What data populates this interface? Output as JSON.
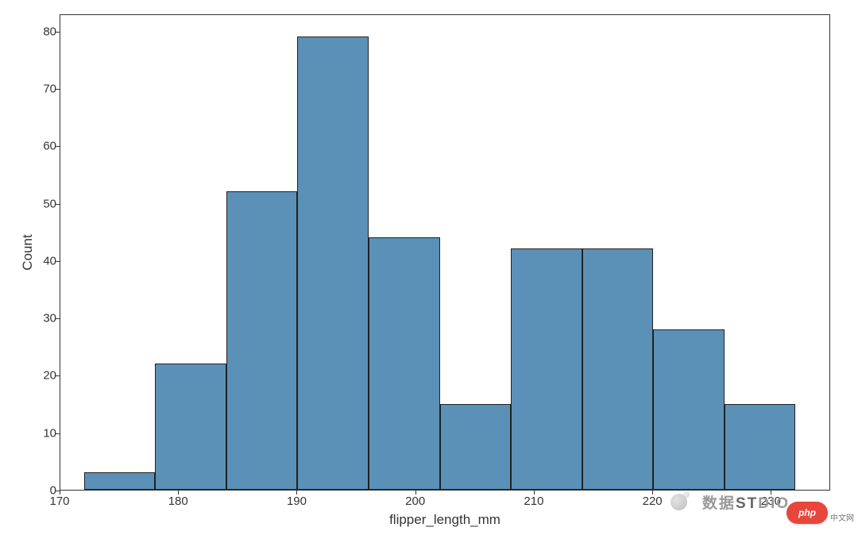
{
  "chart_data": {
    "type": "bar",
    "title": "",
    "xlabel": "flipper_length_mm",
    "ylabel": "Count",
    "xlim": [
      170,
      235
    ],
    "ylim": [
      0,
      83
    ],
    "x_ticks": [
      170,
      180,
      190,
      200,
      210,
      220,
      230
    ],
    "y_ticks": [
      0,
      10,
      20,
      30,
      40,
      50,
      60,
      70,
      80
    ],
    "bin_edges": [
      172,
      178,
      184,
      190,
      196,
      202,
      208,
      214,
      220,
      226,
      232
    ],
    "values": [
      3,
      22,
      52,
      79,
      44,
      15,
      42,
      42,
      28,
      15
    ],
    "bar_color": "#5b91b7"
  },
  "overlay": {
    "watermark_text_left": "数据",
    "watermark_text_right": "DIO",
    "watermark_text_mid": "ST",
    "php_logo_text": "php",
    "cn_text": "中文网"
  }
}
